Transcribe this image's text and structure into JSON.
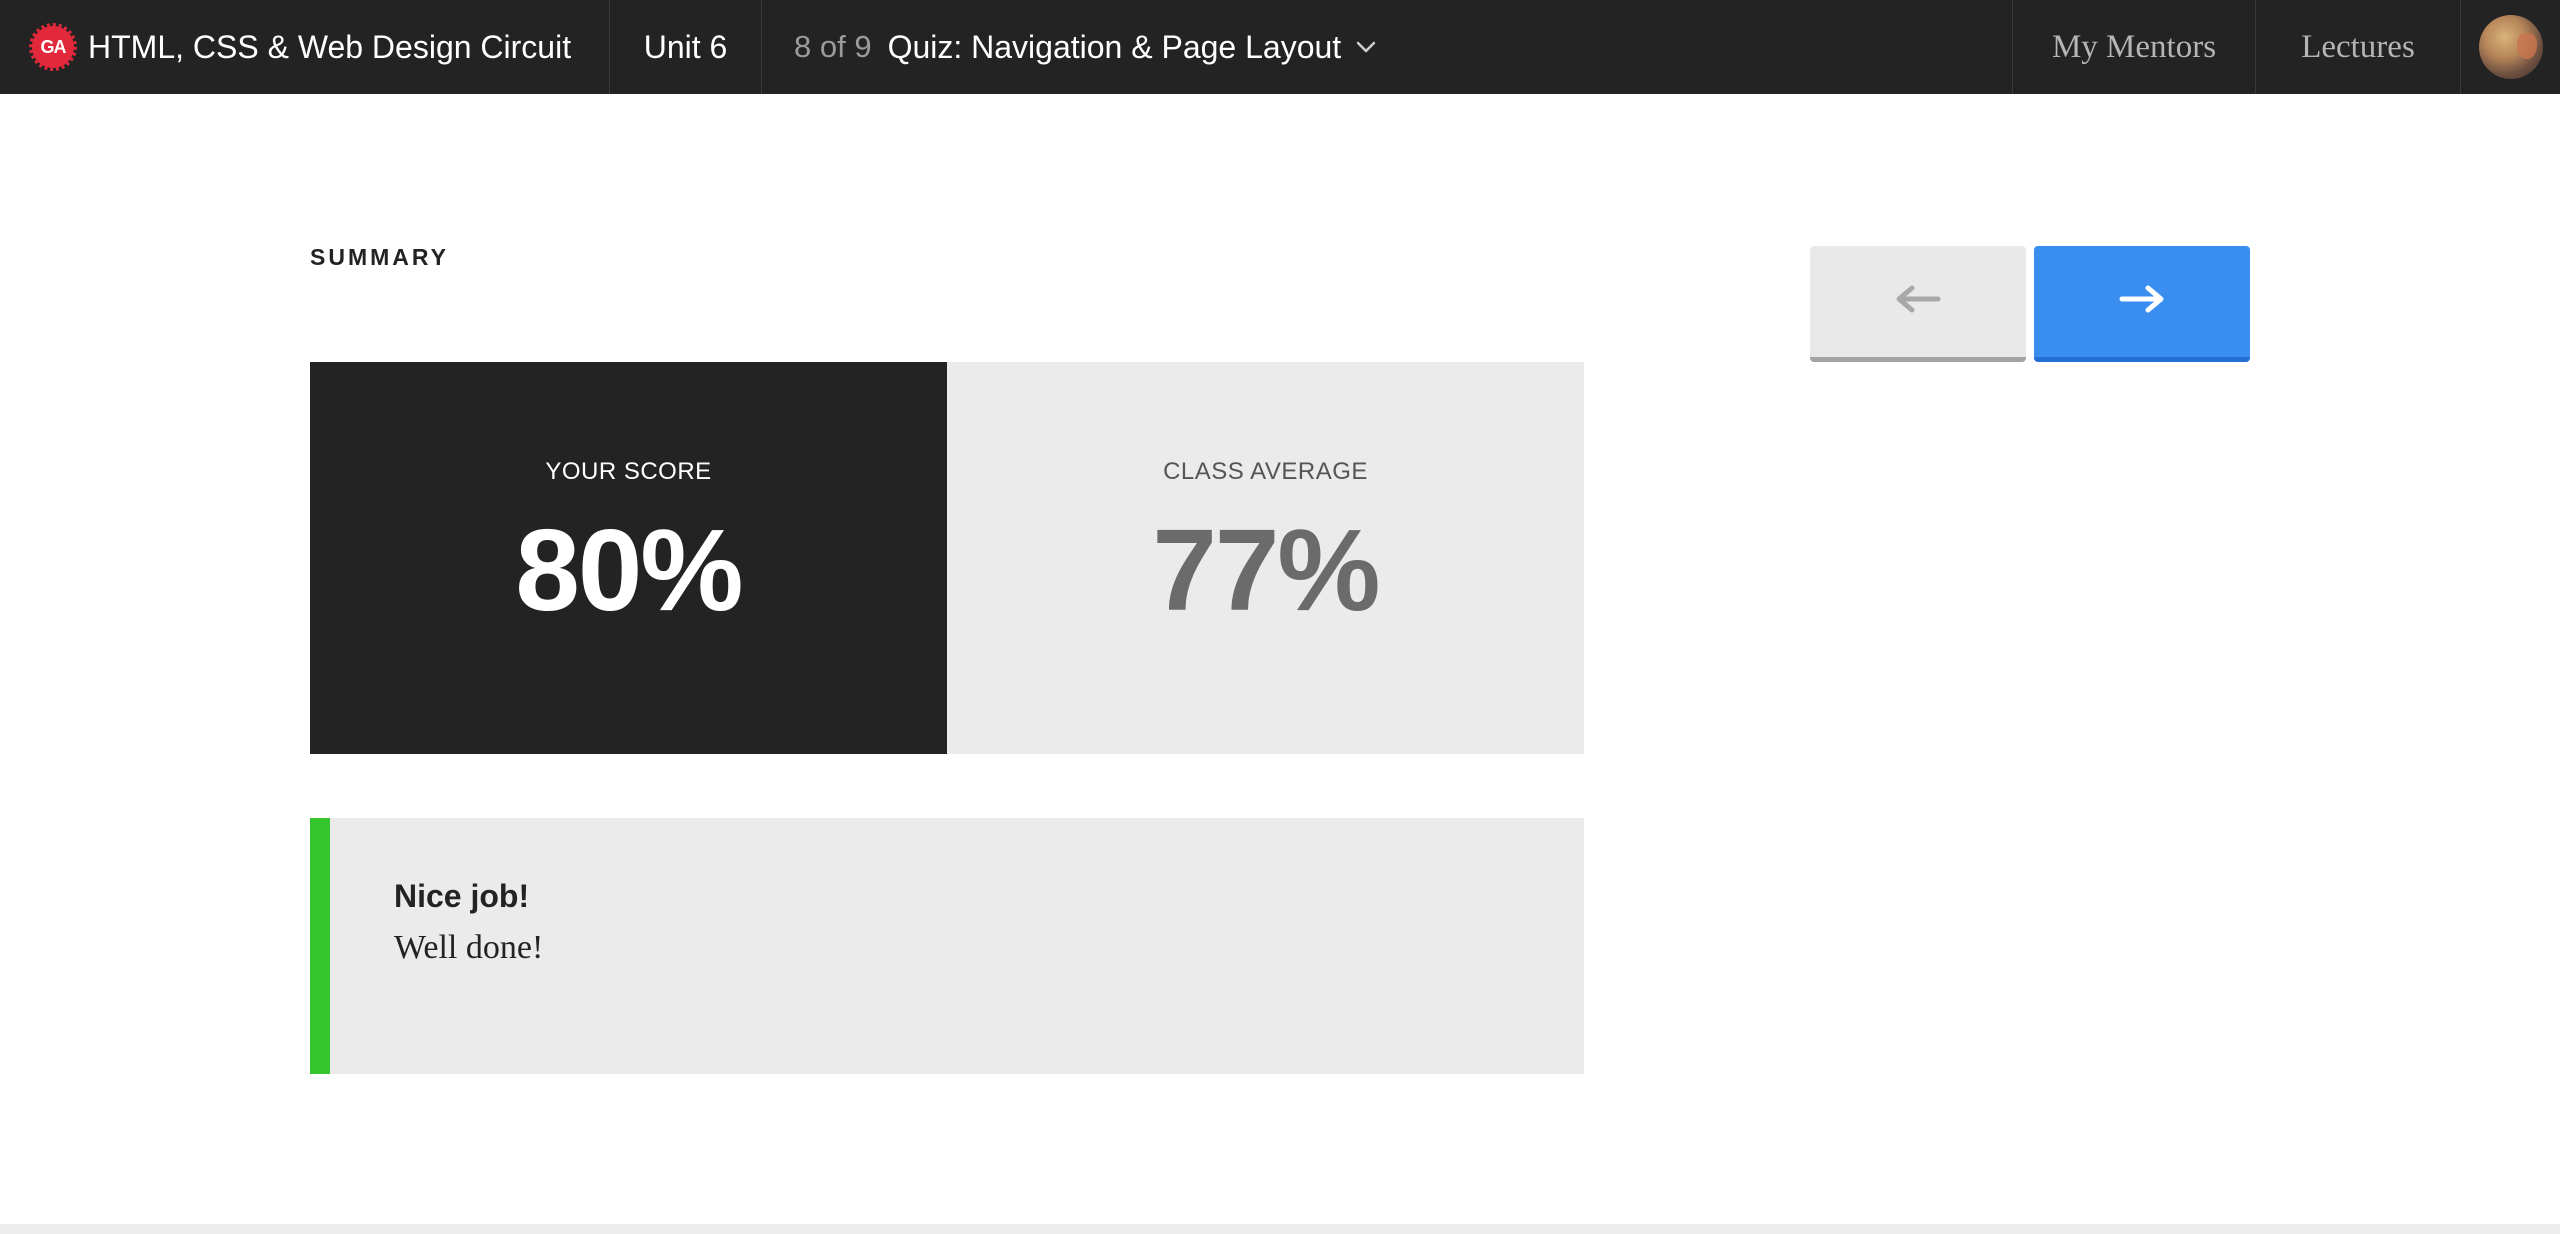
{
  "header": {
    "logo_text": "GA",
    "course_title": "HTML, CSS & Web Design Circuit",
    "unit_label": "Unit 6",
    "lesson_count": "8 of 9",
    "lesson_title": "Quiz: Navigation & Page Layout",
    "mentors_label": "My Mentors",
    "lectures_label": "Lectures"
  },
  "summary": {
    "heading": "SUMMARY",
    "your_score_label": "YOUR SCORE",
    "your_score_value": "80%",
    "class_average_label": "CLASS AVERAGE",
    "class_average_value": "77%"
  },
  "feedback": {
    "title": "Nice job!",
    "body": "Well done!",
    "accent_color": "#34c42c"
  },
  "navigation": {
    "prev_icon": "arrow-left-icon",
    "next_icon": "arrow-right-icon",
    "next_color": "#3a8ef0"
  },
  "colors": {
    "topbar": "#232323",
    "logo": "#e2283b"
  }
}
